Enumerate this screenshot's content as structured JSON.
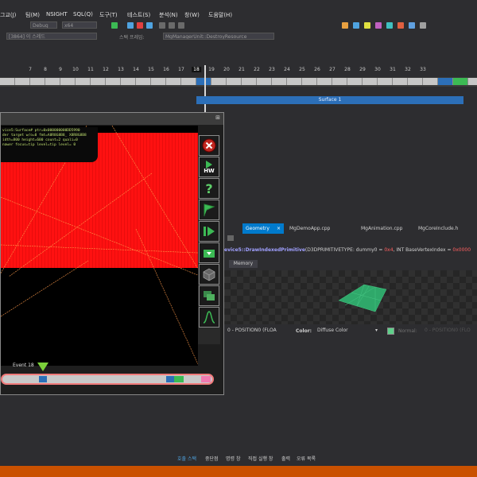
{
  "menu": [
    "그교(J)",
    "팀(M)",
    "NSIGHT",
    "SQL(Q)",
    "도구(T)",
    "테스트(S)",
    "분석(N)",
    "창(W)",
    "도움말(H)"
  ],
  "toolbar": {
    "config_select": "Debug",
    "platform_select": "x64",
    "process_select": "[3864] 이 스레드",
    "stack_label": "스택 프레임:",
    "stack_select": "MgManagerUnit::DestroyResource"
  },
  "ruler": {
    "ticks": [
      "7",
      "8",
      "9",
      "10",
      "11",
      "12",
      "13",
      "14",
      "15",
      "16",
      "17",
      "18",
      "19",
      "20",
      "21",
      "22",
      "23",
      "24",
      "25",
      "26",
      "27",
      "28",
      "29",
      "30",
      "31",
      "32",
      "33"
    ],
    "current_frame": "18"
  },
  "surface_bar": {
    "label": "Surface 1"
  },
  "tool_window": {
    "overlay_lines": [
      "vice5:Surface# ptr=0x000000000DD5990",
      "der target w/o=0 fmt=A8R8G8B8_ X8R8G8B8",
      "idth=800 height=600 count=2 quali=0",
      "nawer focus=tip level=tip level= 0"
    ],
    "event_label": "Event 18"
  },
  "tool_buttons": [
    "close-icon",
    "hw-icon",
    "help-icon",
    "flag-icon",
    "play-icon",
    "folder-icon",
    "cube-icon",
    "layers-icon",
    "curve-icon"
  ],
  "tool_button_labels": {
    "hw": "HW",
    "help": "?"
  },
  "doc_tabs": [
    "Geometry",
    "MgDemoApp.cpp",
    "MgAnimation.cpp",
    "MgCoreInclude.h"
  ],
  "code_line": {
    "prefix": "evice5::DrawIndexedPrimitive",
    "args": "(D3DPRIMITIVETYPE: dummy0 = ",
    "val1": "0x4",
    "mid": ", INT BaseVertexIndex = ",
    "val2": "0x0000"
  },
  "memory_tab": "Memory",
  "geometry_bar": {
    "position_select": "0 - POSITION0 (FLOA",
    "color_label": "Color:",
    "color_select": "Diffuse Color",
    "normal_label": "Normal:",
    "normal_select": "0 - POSITION0 (FLO"
  },
  "status_tabs": [
    "호출 스택",
    "중단점",
    "명령 창",
    "직접 실행 창",
    "출력",
    "오류 목록"
  ],
  "colors": {
    "accent": "#007acc",
    "status_bar": "#ca5100",
    "render_red": "#ff1111",
    "mesh_green": "#2fa86a"
  }
}
